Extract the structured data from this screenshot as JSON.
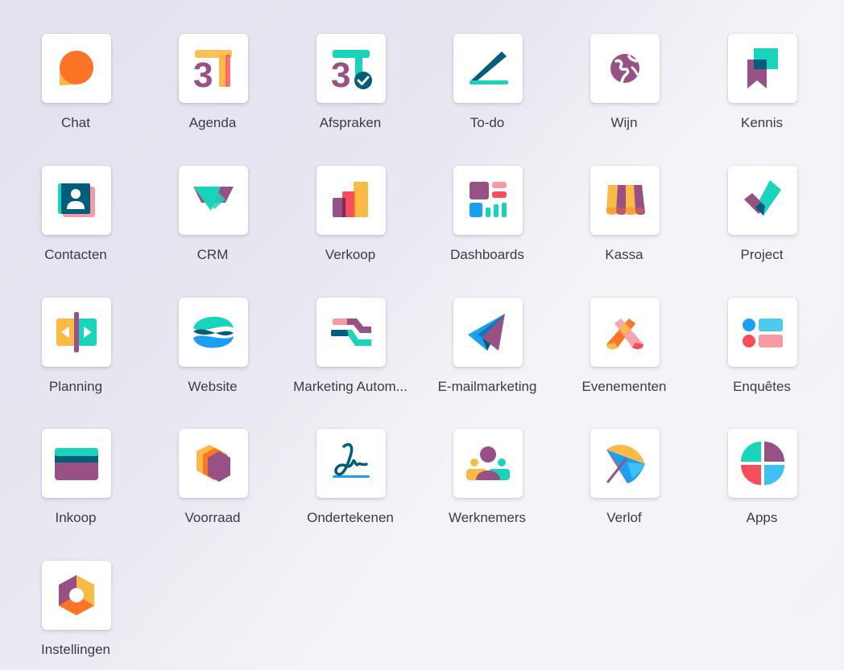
{
  "apps": [
    {
      "label": "Chat",
      "icon": "chat-icon"
    },
    {
      "label": "Agenda",
      "icon": "calendar-icon"
    },
    {
      "label": "Afspraken",
      "icon": "appointment-icon"
    },
    {
      "label": "To-do",
      "icon": "todo-icon"
    },
    {
      "label": "Wijn",
      "icon": "globe-icon"
    },
    {
      "label": "Kennis",
      "icon": "bookmark-icon"
    },
    {
      "label": "Contacten",
      "icon": "contacts-icon"
    },
    {
      "label": "CRM",
      "icon": "handshake-icon"
    },
    {
      "label": "Verkoop",
      "icon": "bar-chart-icon"
    },
    {
      "label": "Dashboards",
      "icon": "dashboard-icon"
    },
    {
      "label": "Kassa",
      "icon": "storefront-icon"
    },
    {
      "label": "Project",
      "icon": "checkmark-icon"
    },
    {
      "label": "Planning",
      "icon": "planning-icon"
    },
    {
      "label": "Website",
      "icon": "website-icon"
    },
    {
      "label": "Marketing Autom...",
      "icon": "automation-icon"
    },
    {
      "label": "E-mailmarketing",
      "icon": "paper-plane-icon"
    },
    {
      "label": "Evenementen",
      "icon": "events-icon"
    },
    {
      "label": "Enquêtes",
      "icon": "survey-icon"
    },
    {
      "label": "Inkoop",
      "icon": "credit-card-icon"
    },
    {
      "label": "Voorraad",
      "icon": "inventory-box-icon"
    },
    {
      "label": "Ondertekenen",
      "icon": "signature-icon"
    },
    {
      "label": "Werknemers",
      "icon": "employees-icon"
    },
    {
      "label": "Verlof",
      "icon": "umbrella-icon"
    },
    {
      "label": "Apps",
      "icon": "apps-icon"
    },
    {
      "label": "Instellingen",
      "icon": "settings-hexagon-icon"
    }
  ],
  "colors": {
    "purple": "#985184",
    "teal": "#1ad3bb",
    "dark_teal": "#005e7a",
    "orange": "#fc7526",
    "yellow": "#fbb945",
    "red": "#f64f5b",
    "blue": "#1c9ff0",
    "pink": "#f49ba5"
  }
}
